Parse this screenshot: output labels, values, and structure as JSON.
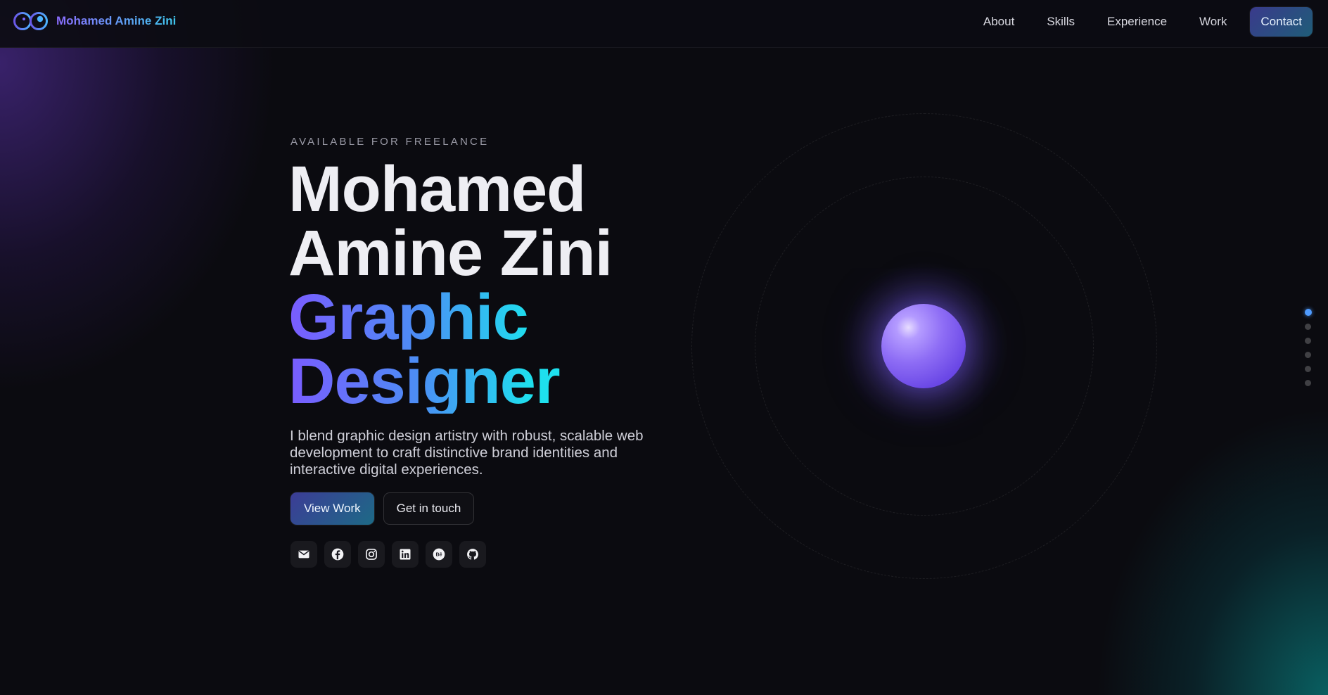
{
  "nav": {
    "brand_name": "Mohamed Amine Zini",
    "links": [
      {
        "label": "About"
      },
      {
        "label": "Skills"
      },
      {
        "label": "Experience"
      },
      {
        "label": "Work"
      }
    ],
    "contact_label": "Contact"
  },
  "hero": {
    "eyebrow": "AVAILABLE FOR FREELANCE",
    "name_line_1": "Mohamed",
    "name_line_2": "Amine Zini",
    "role_line_1": "Graphic",
    "role_line_2": "Designer",
    "blurb": "I blend graphic design artistry with robust, scalable web development to craft distinctive brand identities and interactive digital experiences.",
    "primary_button": "View Work",
    "secondary_button": "Get in touch"
  },
  "socials": [
    {
      "icon": "mail-icon"
    },
    {
      "icon": "facebook-icon"
    },
    {
      "icon": "instagram-icon"
    },
    {
      "icon": "linkedin-icon"
    },
    {
      "icon": "behance-icon"
    },
    {
      "icon": "github-icon"
    }
  ],
  "section_dots": {
    "count": 6,
    "active_index": 0
  },
  "colors": {
    "background": "#0b0b10",
    "accent_purple": "#7a5cff",
    "accent_cyan": "#1ee0ee",
    "active_dot": "#4f9bff"
  }
}
